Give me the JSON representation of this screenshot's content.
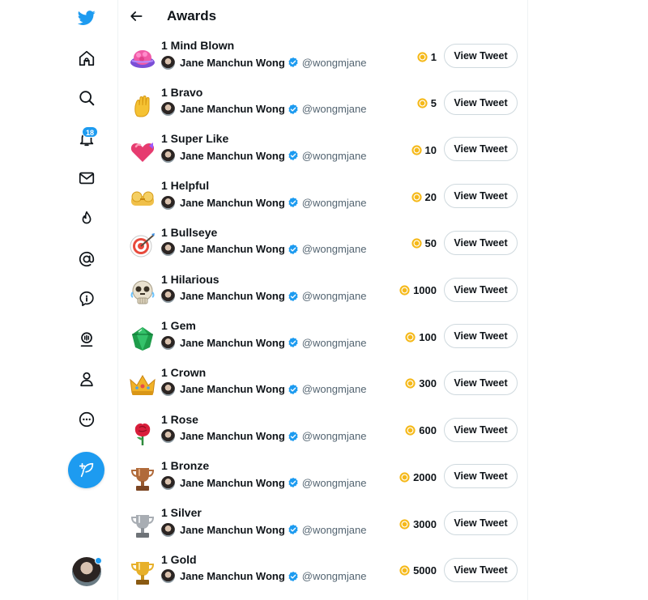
{
  "header": {
    "title": "Awards",
    "back_icon": "arrow-left-icon"
  },
  "nav": {
    "items": [
      {
        "name": "twitter-logo-icon"
      },
      {
        "name": "home-icon"
      },
      {
        "name": "explore-icon"
      },
      {
        "name": "notifications-icon",
        "badge": "18"
      },
      {
        "name": "messages-icon"
      },
      {
        "name": "topics-icon"
      },
      {
        "name": "mentions-icon"
      },
      {
        "name": "spaces-icon"
      },
      {
        "name": "communities-icon"
      },
      {
        "name": "profile-icon"
      },
      {
        "name": "more-icon"
      }
    ],
    "compose_icon": "feather-plus-icon",
    "accent_color": "#1d9bf0"
  },
  "awards": [
    {
      "name": "1 Mind Blown",
      "user": "Jane Manchun Wong",
      "handle": "@wongmjane",
      "amount": "1",
      "button": "View Tweet",
      "icon": "mind-blown"
    },
    {
      "name": "1 Bravo",
      "user": "Jane Manchun Wong",
      "handle": "@wongmjane",
      "amount": "5",
      "button": "View Tweet",
      "icon": "bravo"
    },
    {
      "name": "1 Super Like",
      "user": "Jane Manchun Wong",
      "handle": "@wongmjane",
      "amount": "10",
      "button": "View Tweet",
      "icon": "super-like"
    },
    {
      "name": "1 Helpful",
      "user": "Jane Manchun Wong",
      "handle": "@wongmjane",
      "amount": "20",
      "button": "View Tweet",
      "icon": "helpful"
    },
    {
      "name": "1 Bullseye",
      "user": "Jane Manchun Wong",
      "handle": "@wongmjane",
      "amount": "50",
      "button": "View Tweet",
      "icon": "bullseye"
    },
    {
      "name": "1 Hilarious",
      "user": "Jane Manchun Wong",
      "handle": "@wongmjane",
      "amount": "1000",
      "button": "View Tweet",
      "icon": "hilarious"
    },
    {
      "name": "1 Gem",
      "user": "Jane Manchun Wong",
      "handle": "@wongmjane",
      "amount": "100",
      "button": "View Tweet",
      "icon": "gem"
    },
    {
      "name": "1 Crown",
      "user": "Jane Manchun Wong",
      "handle": "@wongmjane",
      "amount": "300",
      "button": "View Tweet",
      "icon": "crown"
    },
    {
      "name": "1 Rose",
      "user": "Jane Manchun Wong",
      "handle": "@wongmjane",
      "amount": "600",
      "button": "View Tweet",
      "icon": "rose"
    },
    {
      "name": "1 Bronze",
      "user": "Jane Manchun Wong",
      "handle": "@wongmjane",
      "amount": "2000",
      "button": "View Tweet",
      "icon": "bronze-trophy"
    },
    {
      "name": "1 Silver",
      "user": "Jane Manchun Wong",
      "handle": "@wongmjane",
      "amount": "3000",
      "button": "View Tweet",
      "icon": "silver-trophy"
    },
    {
      "name": "1 Gold",
      "user": "Jane Manchun Wong",
      "handle": "@wongmjane",
      "amount": "5000",
      "button": "View Tweet",
      "icon": "gold-trophy"
    }
  ],
  "colors": {
    "coin": "#f5b91a",
    "verified": "#1d9bf0",
    "secondary_text": "#536471"
  }
}
